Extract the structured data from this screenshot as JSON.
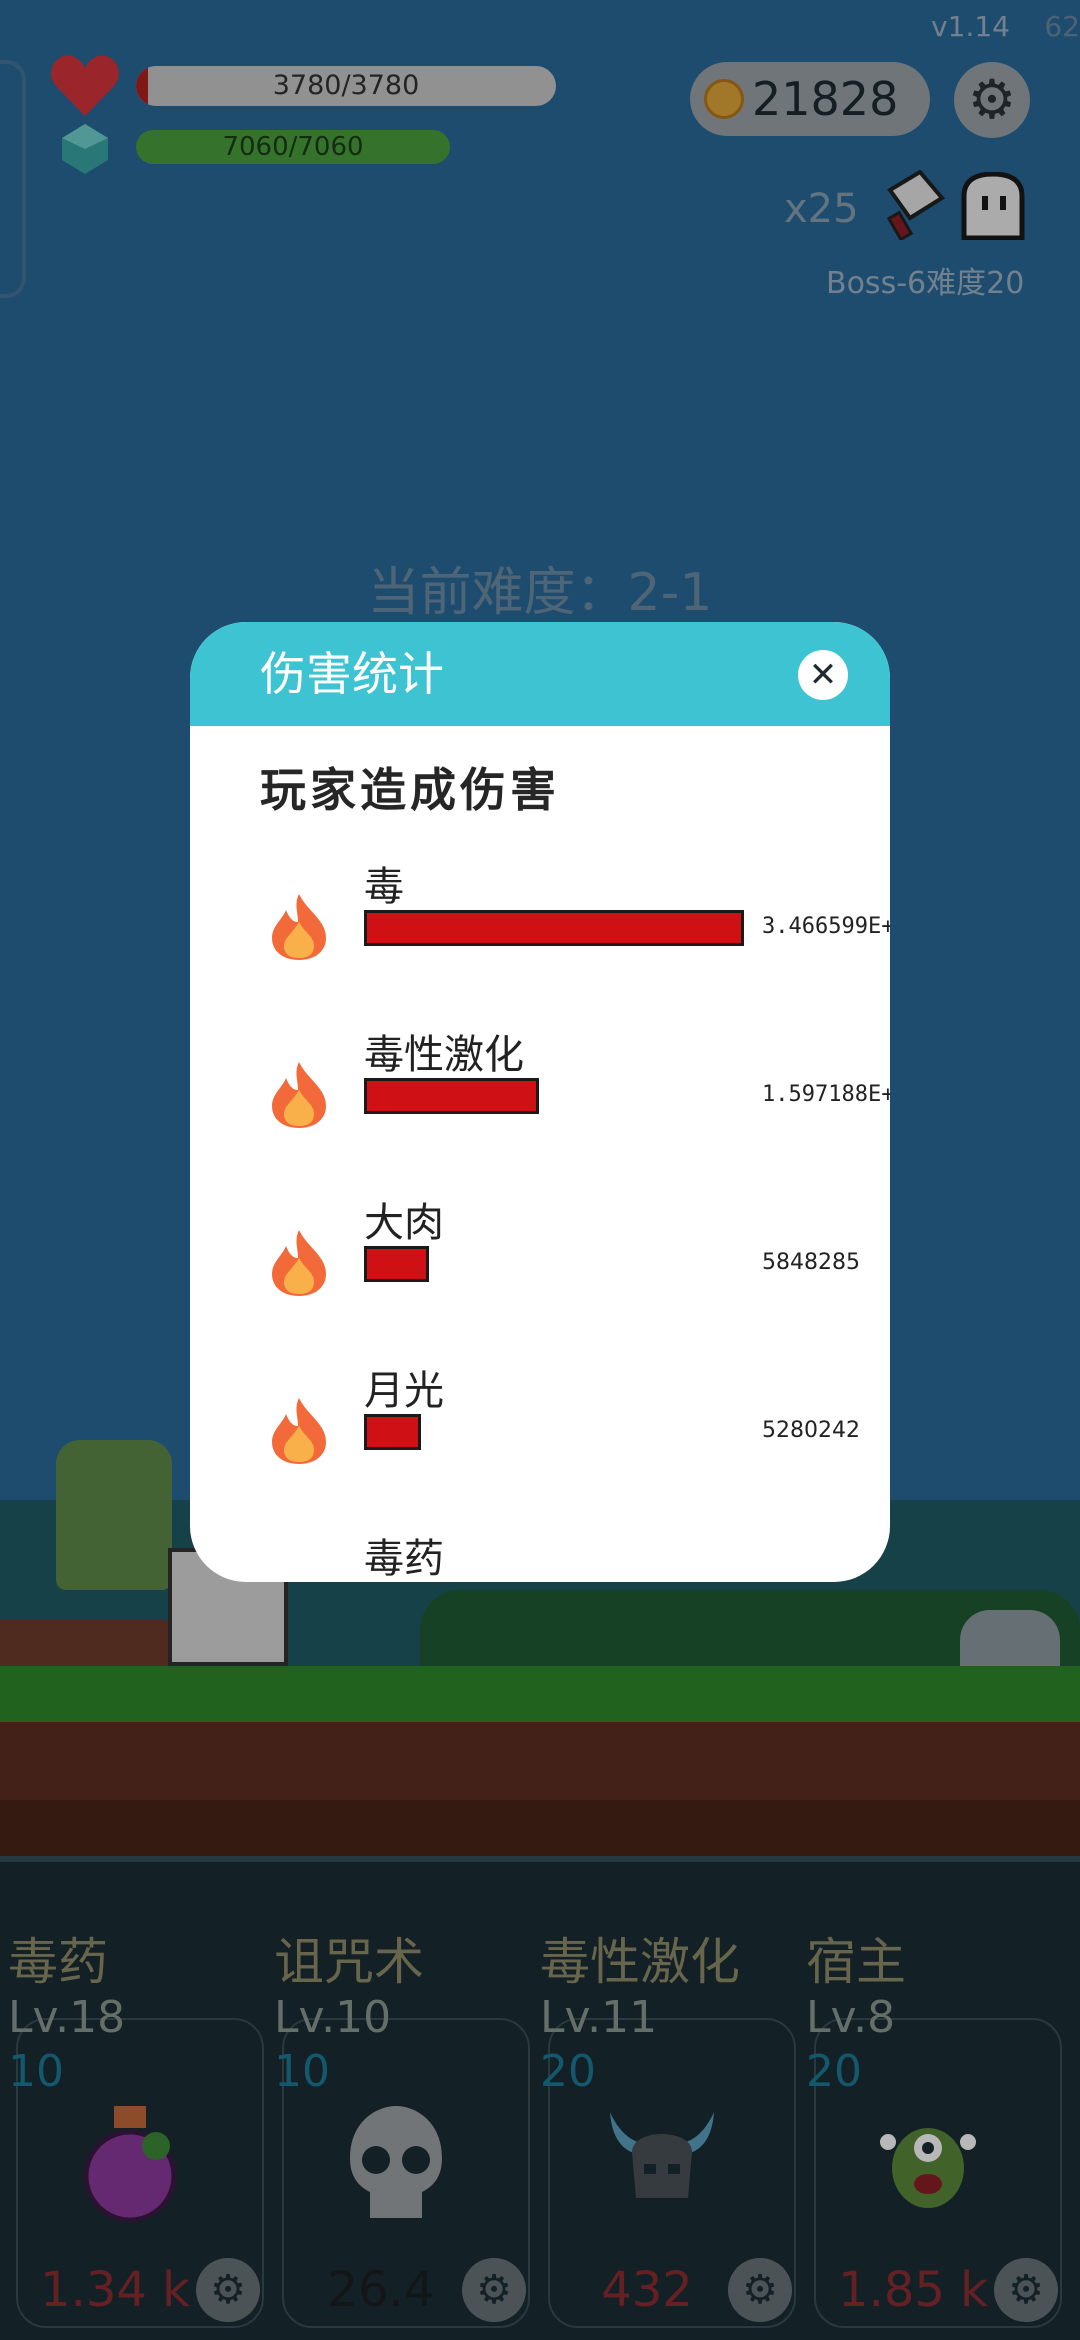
{
  "version": "v1.14",
  "version_extra": "62",
  "hud": {
    "hp_text": "3780/3780",
    "mp_text": "7060/7060",
    "coins": "21828",
    "multiplier": "x25",
    "boss_label": "Boss-6难度20",
    "icons": [
      "heart-icon",
      "gem-icon",
      "coin-icon",
      "gear-icon",
      "cleaver-icon",
      "ghost-icon"
    ]
  },
  "stage": {
    "difficulty": "当前难度：2-1"
  },
  "modal": {
    "title": "伤害统计",
    "close_icon": "close-icon",
    "subtitle": "玩家造成伤害",
    "rows": [
      {
        "name": "毒",
        "value": "3.466599E+",
        "bar_fraction": 1.0
      },
      {
        "name": "毒性激化",
        "value": "1.597188E+",
        "bar_fraction": 0.46
      },
      {
        "name": "大肉",
        "value": "5848285",
        "bar_fraction": 0.17
      },
      {
        "name": "月光",
        "value": "5280242",
        "bar_fraction": 0.15
      },
      {
        "name": "毒药",
        "value": "",
        "bar_fraction": 0.12
      }
    ]
  },
  "skills": [
    {
      "name": "毒药",
      "level": "Lv.18",
      "count": "10",
      "cost": "1.34 k",
      "icon": "potion-icon"
    },
    {
      "name": "诅咒术",
      "level": "Lv.10",
      "count": "10",
      "cost": "26.4",
      "icon": "skull-icon"
    },
    {
      "name": "毒性激化",
      "level": "Lv.11",
      "count": "20",
      "cost": "432",
      "icon": "horned-helmet-icon"
    },
    {
      "name": "宿主",
      "level": "Lv.8",
      "count": "20",
      "cost": "1.85 k",
      "icon": "monster-icon"
    }
  ],
  "colors": {
    "accent": "#3ec3d3",
    "damage_bar": "#cf1116",
    "hp_bar": "#b02020",
    "mp_bar": "#4aa03e"
  }
}
